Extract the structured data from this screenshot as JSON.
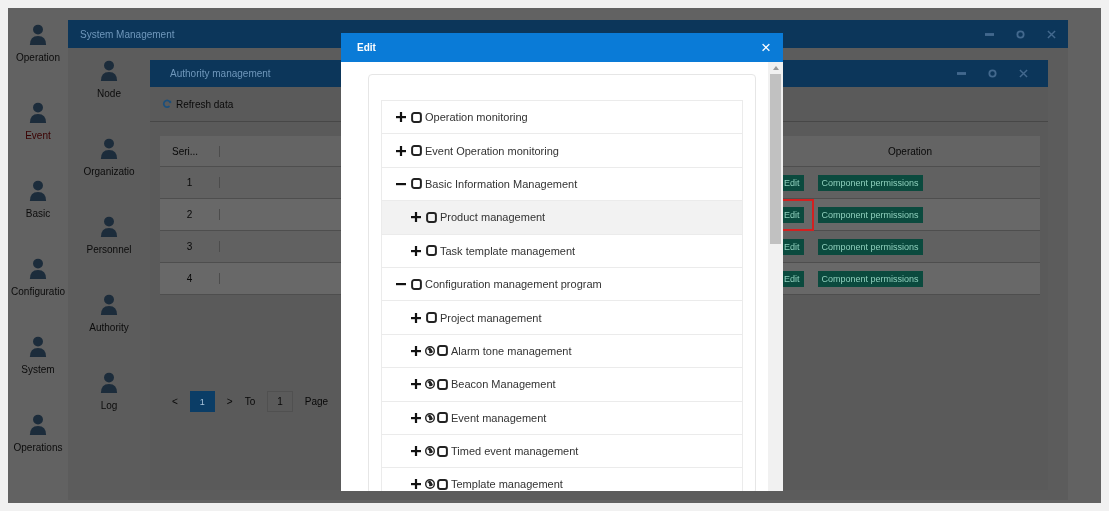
{
  "sidebar": {
    "items": [
      {
        "label": "Operation",
        "selected": false
      },
      {
        "label": "Event",
        "selected": true
      },
      {
        "label": "Basic",
        "selected": false
      },
      {
        "label": "Configuratio",
        "selected": false
      },
      {
        "label": "System",
        "selected": false
      },
      {
        "label": "Operations",
        "selected": false
      }
    ]
  },
  "system_window": {
    "title": "System Management",
    "nav": [
      {
        "label": "Node"
      },
      {
        "label": "Organizatio"
      },
      {
        "label": "Personnel"
      },
      {
        "label": "Authority"
      },
      {
        "label": "Log"
      }
    ]
  },
  "authority_window": {
    "title": "Authority management",
    "refresh": "Refresh data",
    "table": {
      "columns": [
        "Seri...",
        "Operation"
      ],
      "rows": [
        {
          "serial": "1",
          "actions": [
            "Edit",
            "Component permissions"
          ],
          "highlighted": false
        },
        {
          "serial": "2",
          "actions": [
            "Edit",
            "Component permissions"
          ],
          "highlighted": true
        },
        {
          "serial": "3",
          "actions": [
            "Edit",
            "Component permissions"
          ],
          "highlighted": false
        },
        {
          "serial": "4",
          "actions": [
            "Edit",
            "Component permissions"
          ],
          "highlighted": false
        }
      ]
    },
    "pagination": {
      "prev": "<",
      "current": "1",
      "next": ">",
      "goto_label": "To",
      "goto_value": "1",
      "page_label": "Page"
    }
  },
  "modal": {
    "title": "Edit",
    "close": "×",
    "tree": [
      {
        "label": "Operation monitoring",
        "kind": "plain",
        "expanded": false,
        "checked": false,
        "selected": false
      },
      {
        "label": "Event Operation monitoring",
        "kind": "plain",
        "expanded": false,
        "checked": false,
        "selected": false
      },
      {
        "label": "Basic Information Management",
        "kind": "plain",
        "expanded": true,
        "checked": false,
        "selected": false,
        "children": [
          {
            "label": "Product management",
            "kind": "plain",
            "expanded": false,
            "checked": false,
            "selected": true
          },
          {
            "label": "Task template management",
            "kind": "plain",
            "expanded": false,
            "checked": false,
            "selected": false
          }
        ]
      },
      {
        "label": "Configuration management program",
        "kind": "plain",
        "expanded": true,
        "checked": false,
        "selected": false,
        "children": [
          {
            "label": "Project management",
            "kind": "plain",
            "expanded": false,
            "checked": false,
            "selected": false
          },
          {
            "label": "Alarm tone management",
            "kind": "linked",
            "expanded": false,
            "checked": false,
            "selected": false
          },
          {
            "label": "Beacon Management",
            "kind": "linked",
            "expanded": false,
            "checked": false,
            "selected": false
          },
          {
            "label": "Event management",
            "kind": "linked",
            "expanded": false,
            "checked": false,
            "selected": false
          },
          {
            "label": "Timed event management",
            "kind": "linked",
            "expanded": false,
            "checked": false,
            "selected": false
          },
          {
            "label": "Template management",
            "kind": "linked",
            "expanded": false,
            "checked": false,
            "selected": false
          }
        ]
      }
    ]
  }
}
